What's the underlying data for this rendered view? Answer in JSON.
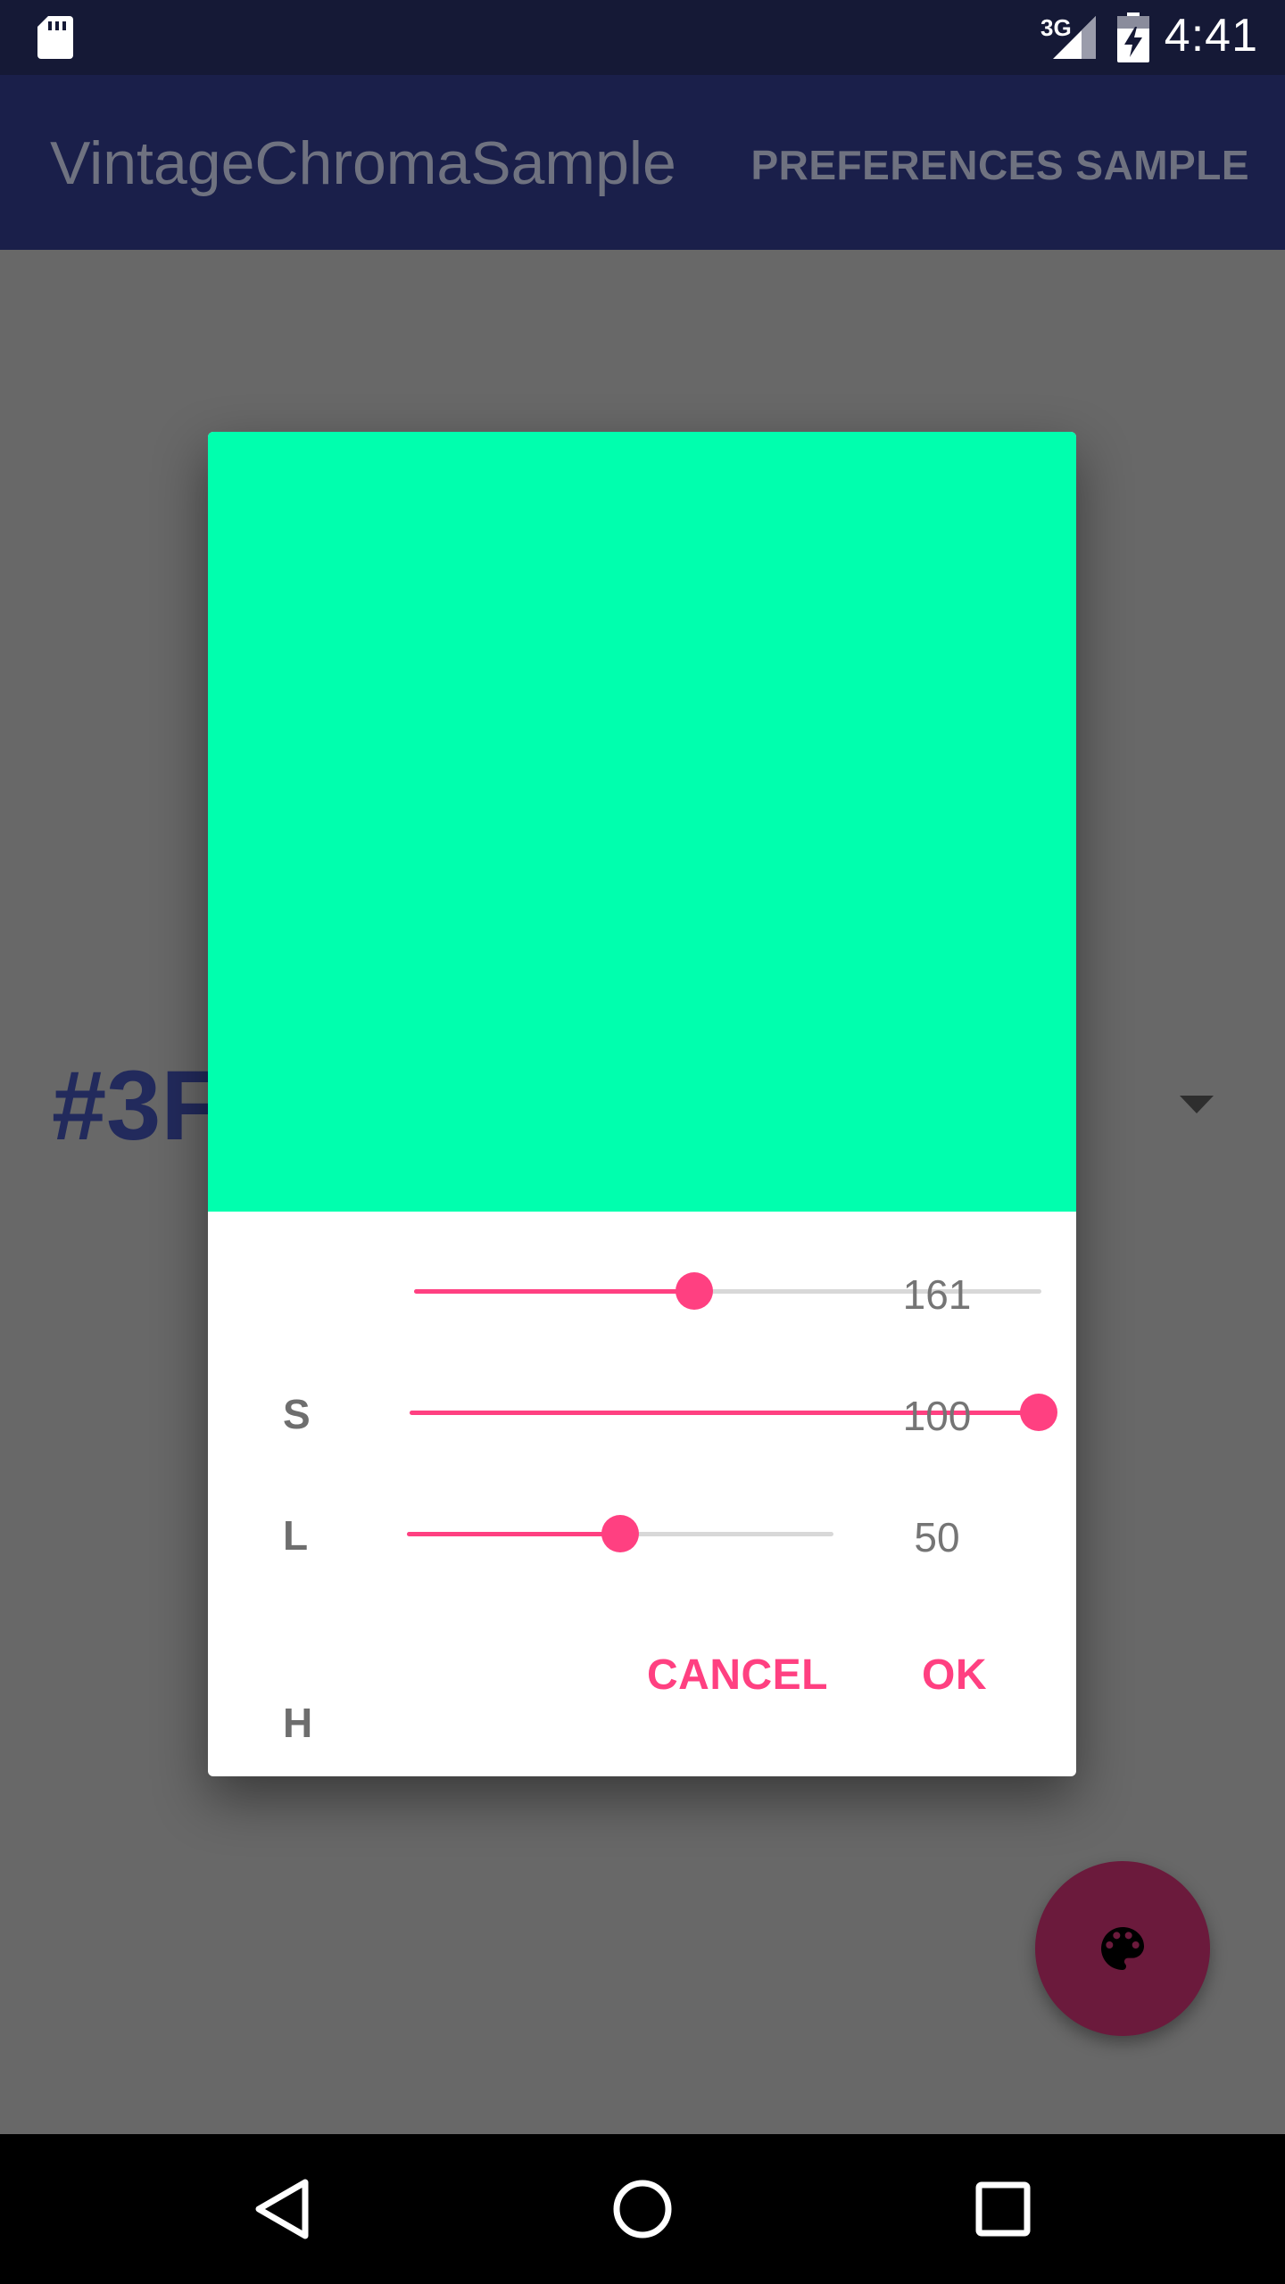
{
  "status_bar": {
    "time": "4:41",
    "network_type": "3G",
    "icons": [
      "sd-card-icon",
      "cell-signal-icon",
      "battery-charging-icon"
    ]
  },
  "app_bar": {
    "title": "VintageChromaSample",
    "action_label": "PREFERENCES SAMPLE"
  },
  "background": {
    "hex_text": "#3F",
    "dropdown_icon": "arrow-drop-down-icon"
  },
  "dialog": {
    "preview_color": "#00FFAE",
    "channels": [
      {
        "label": "H",
        "value": "161",
        "fraction": 0.447
      },
      {
        "label": "S",
        "value": "100",
        "fraction": 1.0
      },
      {
        "label": "L",
        "value": "50",
        "fraction": 0.5
      }
    ],
    "cancel_label": "CANCEL",
    "ok_label": "OK",
    "accent_color": "#FF4081"
  },
  "fab": {
    "icon": "palette-icon",
    "color": "#6B1A3C"
  },
  "nav_bar": {
    "icons": [
      "back-icon",
      "home-icon",
      "recents-icon"
    ]
  }
}
